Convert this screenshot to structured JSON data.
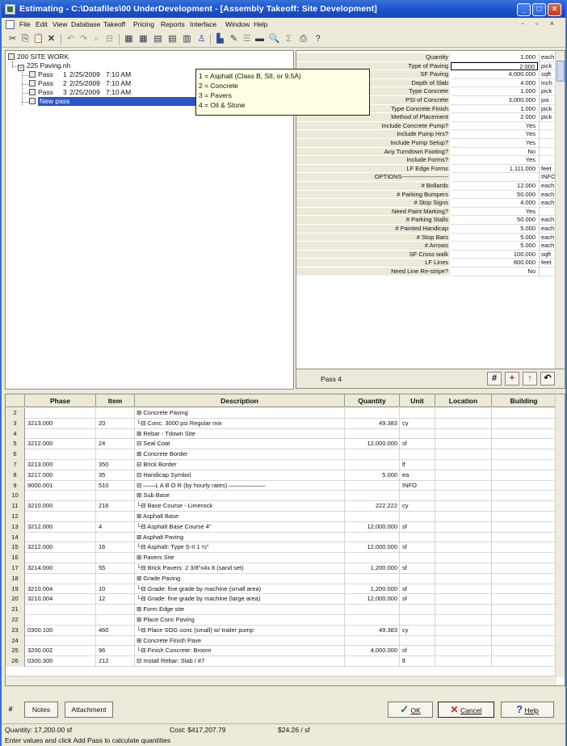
{
  "window": {
    "title": "Estimating - C:\\Datafiles\\00 UnderDevelopment - [Assembly Takeoff: Site Development]",
    "controls": [
      "_",
      "□",
      "×"
    ]
  },
  "menu": [
    "File",
    "Edit",
    "View",
    "Database",
    "Takeoff",
    "Pricing",
    "Reports",
    "Interface",
    "Window",
    "Help"
  ],
  "tree": {
    "root": "200 SITE WORK",
    "child": "225  Paving.nh",
    "passes": [
      {
        "label": "Pass",
        "num": "1",
        "date": "2/25/2009",
        "time": "7:10 AM"
      },
      {
        "label": "Pass",
        "num": "2",
        "date": "2/25/2009",
        "time": "7:10 AM"
      },
      {
        "label": "Pass",
        "num": "3",
        "date": "2/25/2009",
        "time": "7:10 AM"
      }
    ],
    "new_pass": "New pass"
  },
  "tooltip": [
    "1 = Asphalt (Class B, SII, or 9.5A)",
    "2 = Concrete",
    "3 = Pavers",
    "4 = Oil & Stone"
  ],
  "properties": [
    {
      "label": "Quantity",
      "value": "1.000",
      "unit": "each"
    },
    {
      "label": "Type of Paving",
      "value": "2.000",
      "unit": "pick"
    },
    {
      "label": "SF Paving",
      "value": "4,000.000",
      "unit": "sqft"
    },
    {
      "label": "Depth of Slab",
      "value": "4.000",
      "unit": "inch"
    },
    {
      "label": "Type Concrete",
      "value": "1.000",
      "unit": "pick"
    },
    {
      "label": "PSI of Concrete",
      "value": "3,000.000",
      "unit": "psi"
    },
    {
      "label": "Type Concrete Finish",
      "value": "1.000",
      "unit": "pick"
    },
    {
      "label": "Method of Placement",
      "value": "2.000",
      "unit": "pick"
    },
    {
      "label": "Include Concrete Pump?",
      "value": "Yes",
      "unit": ""
    },
    {
      "label": "Include Pump Hrs?",
      "value": "Yes",
      "unit": ""
    },
    {
      "label": "Include Pump Setup?",
      "value": "Yes",
      "unit": ""
    },
    {
      "label": "Any Turndown Footing?",
      "value": "No",
      "unit": ""
    },
    {
      "label": "Include Forms?",
      "value": "Yes",
      "unit": ""
    },
    {
      "label": "LF Edge Forms",
      "value": "1,111.000",
      "unit": "feet"
    },
    {
      "label": "OPTIONS-----------------------",
      "value": "",
      "unit": "INFO"
    },
    {
      "label": "# Bollards",
      "value": "12.000",
      "unit": "each"
    },
    {
      "label": "# Parking Bumpers",
      "value": "50.000",
      "unit": "each"
    },
    {
      "label": "# Stop Signs",
      "value": "4.000",
      "unit": "each"
    },
    {
      "label": "Need Paint Marking?",
      "value": "Yes",
      "unit": ""
    },
    {
      "label": "# Parking Stalls",
      "value": "50.000",
      "unit": "each"
    },
    {
      "label": "# Painted Handicap",
      "value": "5.000",
      "unit": "each"
    },
    {
      "label": "# Stop Bars",
      "value": "5.000",
      "unit": "each"
    },
    {
      "label": "# Arrows",
      "value": "5.000",
      "unit": "each"
    },
    {
      "label": "SF Cross walk",
      "value": "100.000",
      "unit": "sqft"
    },
    {
      "label": "LF Lines",
      "value": "800.000",
      "unit": "feet"
    },
    {
      "label": "Need Line Re-stripe?",
      "value": "No",
      "unit": ""
    }
  ],
  "passbar": {
    "label": "Pass 4",
    "buttons": [
      "#",
      "+",
      "↑",
      "↶"
    ]
  },
  "grid": {
    "headers": [
      "",
      "Phase",
      "Item",
      "Description",
      "Quantity",
      "Unit",
      "Location",
      "Building"
    ],
    "rows": [
      [
        "2",
        "",
        "",
        "⊞ Concrete Paving",
        "",
        ""
      ],
      [
        "3",
        "3213.000",
        "20",
        "  └⊟ Conc. 3000 psi Regular mix",
        "49.383",
        "cy"
      ],
      [
        "4",
        "",
        "",
        "⊞ Rebar - Tdown Site",
        "",
        ""
      ],
      [
        "5",
        "3212.000",
        "24",
        "⊟ Seal Coat",
        "12,000.000",
        "sf"
      ],
      [
        "6",
        "",
        "",
        "⊞ Concrete Border",
        "",
        ""
      ],
      [
        "7",
        "3213.000",
        "350",
        "⊟ Brick Border",
        "",
        "lf"
      ],
      [
        "8",
        "3217.000",
        "35",
        "⊟ Handicap Symbol",
        "5.000",
        "ea"
      ],
      [
        "9",
        "9000.001",
        "510",
        "⊟ ——L A B O R (by hourly rates) ——————",
        "",
        "INFO"
      ],
      [
        "10",
        "",
        "",
        "⊞ Sub Base",
        "",
        ""
      ],
      [
        "11",
        "3210.000",
        "216",
        "  └⊟ Base Course - Limerock",
        "222.222",
        "cy"
      ],
      [
        "12",
        "",
        "",
        "⊞ Asphalt Base",
        "",
        ""
      ],
      [
        "13",
        "3212.000",
        "4",
        "  └⊟ Asphalt Base Course 4\"",
        "12,000.000",
        "sf"
      ],
      [
        "14",
        "",
        "",
        "⊞ Asphalt Paving",
        "",
        ""
      ],
      [
        "15",
        "3212.000",
        "16",
        "  └⊟ Asphalt: Type S-II  1 ½\"",
        "12,000.000",
        "sf"
      ],
      [
        "16",
        "",
        "",
        "⊞ Pavers Site",
        "",
        ""
      ],
      [
        "17",
        "3214.000",
        "55",
        "  └⊟ Brick Pavers: 2 3/8\"x4x 8 (sand set)",
        "1,200.000",
        "sf"
      ],
      [
        "18",
        "",
        "",
        "⊞ Grade Paving",
        "",
        ""
      ],
      [
        "19",
        "3210.004",
        "10",
        "  └⊟ Grade: fine grade by machine (small area)",
        "1,200.000",
        "sf"
      ],
      [
        "20",
        "3210.004",
        "12",
        "  └⊟ Grade: fine grade by machine (large area)",
        "12,000.000",
        "sf"
      ],
      [
        "21",
        "",
        "",
        "⊞ Form Edge site",
        "",
        ""
      ],
      [
        "22",
        "",
        "",
        "⊞ Place Conc Paving",
        "",
        ""
      ],
      [
        "23",
        "0300.100",
        "460",
        "  └⊟ Place SOG conc (small) w/ trailer pump",
        "49.383",
        "cy"
      ],
      [
        "24",
        "",
        "",
        "⊞ Concrete Finish Pave",
        "",
        ""
      ],
      [
        "25",
        "3200.002",
        "96",
        "  └⊟ Finish Concrete: Broom",
        "4,000.000",
        "sf"
      ],
      [
        "26",
        "0300.300",
        "212",
        "⊟ Install Rebar: Slab / #7",
        "",
        "lf"
      ]
    ]
  },
  "buttons": {
    "hash": "#",
    "notes": "Notes",
    "attachment": "Attachment",
    "ok": "OK",
    "cancel": "Cancel",
    "help": "Help"
  },
  "status": {
    "quantity": "Quantity: 17,200.00 sf",
    "cost": "Cost: $417,207.79",
    "rate": "$24.26 / sf",
    "hint": "Enter values and click Add Pass to calculate quantities"
  }
}
